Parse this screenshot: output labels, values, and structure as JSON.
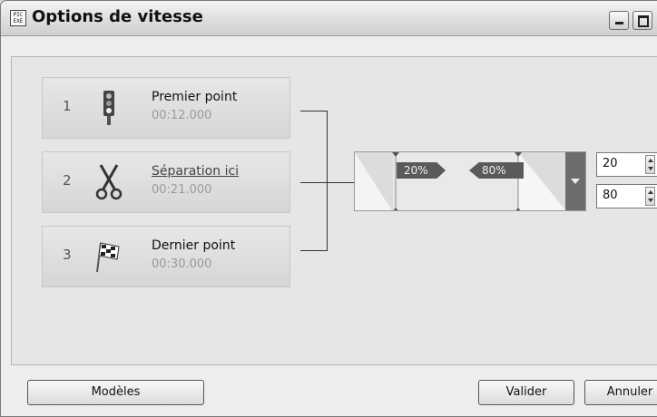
{
  "window": {
    "title": "Options de vitesse",
    "app_icon_text": "PIC EXE"
  },
  "points": [
    {
      "number": "1",
      "name": "Premier point",
      "time": "00:12.000",
      "icon": "traffic-light-icon"
    },
    {
      "number": "2",
      "name": "Séparation ici",
      "time": "00:21.000",
      "icon": "scissors-icon"
    },
    {
      "number": "3",
      "name": "Dernier point",
      "time": "00:30.000",
      "icon": "checkered-flag-icon"
    }
  ],
  "speed": {
    "start_label": "20%",
    "end_label": "80%",
    "start_value": "20",
    "end_value": "80"
  },
  "buttons": {
    "templates": "Modèles",
    "ok": "Valider",
    "cancel": "Annuler"
  }
}
